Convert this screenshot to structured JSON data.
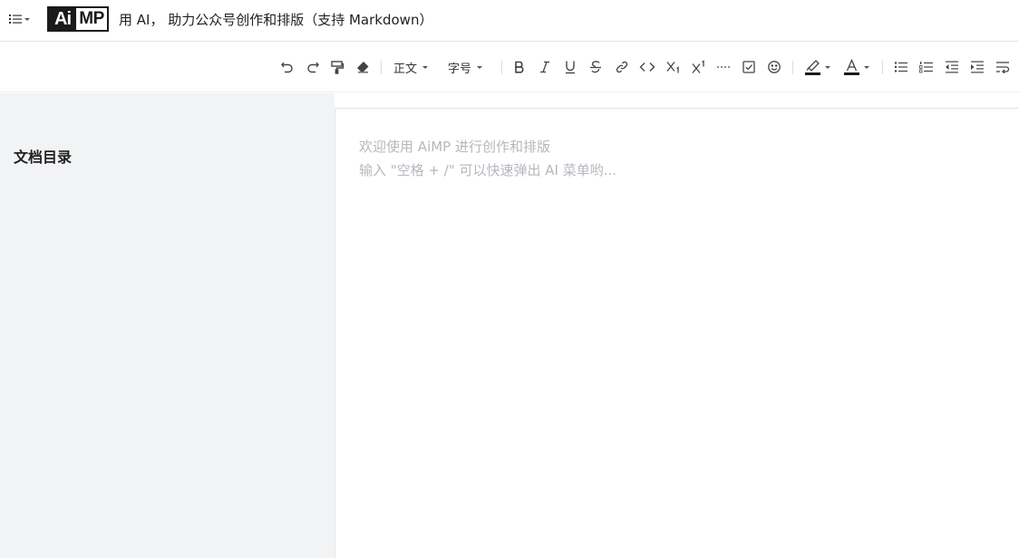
{
  "header": {
    "logo_text_ai": "Ai",
    "logo_text_mp": "MP",
    "slogan": "用 AI， 助力公众号创作和排版（支持 Markdown）"
  },
  "toolbar": {
    "paragraph_style": "正文",
    "font_size": "字号",
    "highlight_color": "#1a1a1a",
    "text_color": "#1a1a1a"
  },
  "sidebar": {
    "title": "文档目录"
  },
  "editor": {
    "placeholder_line1": "欢迎使用 AiMP 进行创作和排版",
    "placeholder_line2": "输入 \"空格 + /\" 可以快速弹出 AI 菜单哟..."
  }
}
